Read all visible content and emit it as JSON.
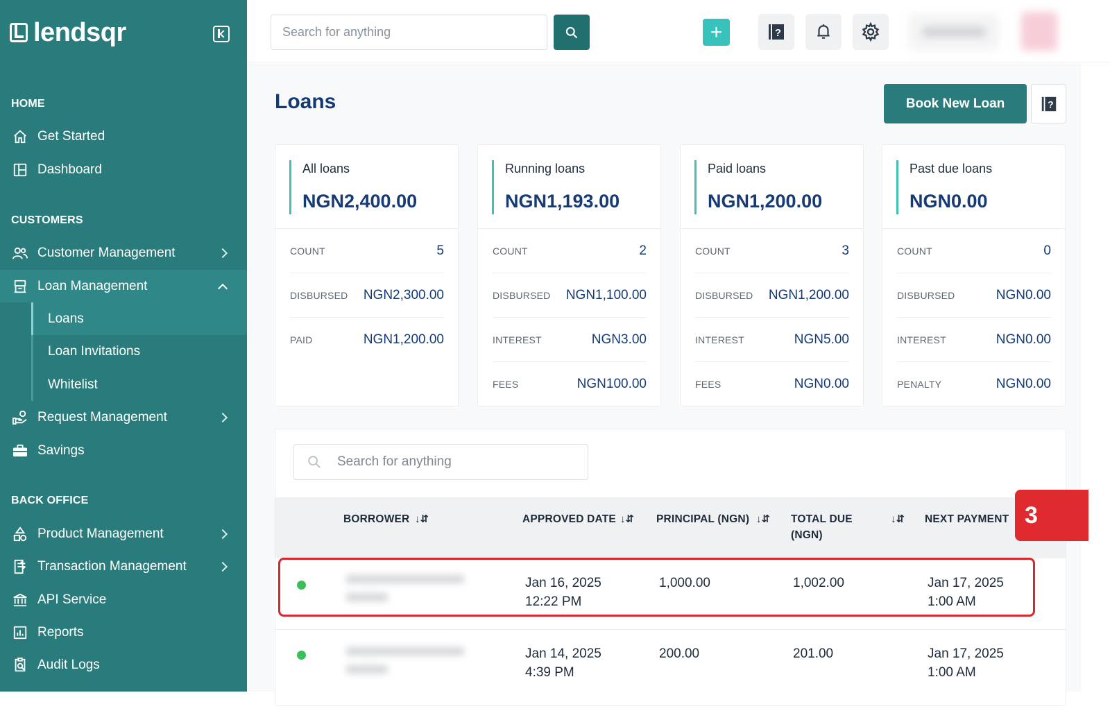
{
  "app": {
    "brand": "lendsqr"
  },
  "sidebar": {
    "sections": {
      "home": "HOME",
      "customers": "CUSTOMERS",
      "back_office": "BACK OFFICE"
    },
    "items": {
      "get_started": "Get Started",
      "dashboard": "Dashboard",
      "customer_management": "Customer Management",
      "loan_management": "Loan Management",
      "request_management": "Request Management",
      "savings": "Savings",
      "product_management": "Product Management",
      "transaction_management": "Transaction Management",
      "api_service": "API Service",
      "reports": "Reports",
      "audit_logs": "Audit Logs"
    },
    "loan_submenu": {
      "loans": "Loans",
      "loan_invitations": "Loan Invitations",
      "whitelist": "Whitelist"
    }
  },
  "header": {
    "search_placeholder": "Search for anything",
    "add_label": "+"
  },
  "page": {
    "title": "Loans",
    "book_button": "Book New Loan"
  },
  "cards": [
    {
      "title": "All loans",
      "amount": "NGN2,400.00",
      "rows": [
        {
          "label": "COUNT",
          "value": "5"
        },
        {
          "label": "DISBURSED",
          "value": "NGN2,300.00"
        },
        {
          "label": "PAID",
          "value": "NGN1,200.00"
        }
      ]
    },
    {
      "title": "Running loans",
      "amount": "NGN1,193.00",
      "rows": [
        {
          "label": "COUNT",
          "value": "2"
        },
        {
          "label": "DISBURSED",
          "value": "NGN1,100.00"
        },
        {
          "label": "INTEREST",
          "value": "NGN3.00"
        },
        {
          "label": "FEES",
          "value": "NGN100.00"
        }
      ]
    },
    {
      "title": "Paid loans",
      "amount": "NGN1,200.00",
      "rows": [
        {
          "label": "COUNT",
          "value": "3"
        },
        {
          "label": "DISBURSED",
          "value": "NGN1,200.00"
        },
        {
          "label": "INTEREST",
          "value": "NGN5.00"
        },
        {
          "label": "FEES",
          "value": "NGN0.00"
        }
      ]
    },
    {
      "title": "Past due loans",
      "amount": "NGN0.00",
      "rows": [
        {
          "label": "COUNT",
          "value": "0"
        },
        {
          "label": "DISBURSED",
          "value": "NGN0.00"
        },
        {
          "label": "INTEREST",
          "value": "NGN0.00"
        },
        {
          "label": "PENALTY",
          "value": "NGN0.00"
        }
      ]
    }
  ],
  "table": {
    "search_placeholder": "Search for anything",
    "columns": {
      "borrower": "BORROWER",
      "approved_date": "APPROVED DATE",
      "principal": "PRINCIPAL (NGN)",
      "total_due": "TOTAL DUE",
      "total_due_line2": "(NGN)",
      "next_payment": "NEXT PAYMENT"
    },
    "sort_glyph": "↓⇵",
    "rows": [
      {
        "approved_date": "Jan 16, 2025",
        "approved_time": "12:22 PM",
        "principal": "1,000.00",
        "total_due": "1,002.00",
        "next_date": "Jan 17, 2025",
        "next_time": "1:00 AM",
        "status_color": "#3bbf5a"
      },
      {
        "approved_date": "Jan 14, 2025",
        "approved_time": "4:39 PM",
        "principal": "200.00",
        "total_due": "201.00",
        "next_date": "Jan 17, 2025",
        "next_time": "1:00 AM",
        "status_color": "#3bbf5a"
      }
    ]
  },
  "annotation": {
    "step": "3",
    "color": "#df2a2f"
  },
  "colors": {
    "brand": "#2a7c7c",
    "navy": "#163a73",
    "accent": "#3fbfb6"
  }
}
